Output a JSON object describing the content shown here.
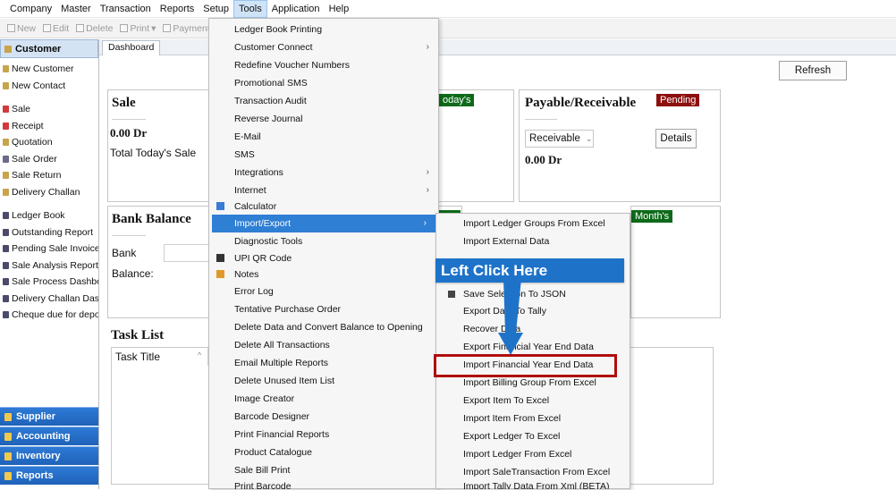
{
  "menubar": [
    "Company",
    "Master",
    "Transaction",
    "Reports",
    "Setup",
    "Tools",
    "Application",
    "Help"
  ],
  "toolbar": [
    "New",
    "Edit",
    "Delete",
    "Print",
    "Payment L"
  ],
  "sidebar": {
    "header": "Customer",
    "items": [
      "New Customer",
      "New Contact",
      "Sale",
      "Receipt",
      "Quotation",
      "Sale Order",
      "Sale Return",
      "Delivery Challan",
      "Ledger Book",
      "Outstanding Report",
      "Pending Sale Invoices",
      "Sale Analysis Report",
      "Sale Process Dashboa",
      "Delivery Challan Dashl",
      "Cheque due for depos"
    ],
    "bottom": [
      "Supplier",
      "Accounting",
      "Inventory",
      "Reports"
    ]
  },
  "tab": "Dashboard",
  "dashboard": {
    "refresh_label": "Refresh",
    "sale": {
      "title": "Sale",
      "value": "0.00 Dr",
      "caption": "Total Today's Sale"
    },
    "todays_badge": "oday's",
    "payable": {
      "title": "Payable/Receivable",
      "badge": "Pending",
      "select": "Receivable",
      "details_label": "Details",
      "value": "0.00 Dr"
    },
    "bank": {
      "title": "Bank Balance",
      "bank_label": "Bank",
      "balance_label": "Balance:"
    },
    "months_badge": "Month's",
    "tasklist": {
      "title": "Task List",
      "column": "Task Title"
    }
  },
  "tools_menu": [
    {
      "label": "Ledger Book Printing",
      "arrow": false
    },
    {
      "label": "Customer Connect",
      "arrow": true
    },
    {
      "label": "Redefine Voucher Numbers",
      "arrow": false
    },
    {
      "label": "Promotional SMS",
      "arrow": false
    },
    {
      "label": "Transaction Audit",
      "arrow": false
    },
    {
      "label": "Reverse Journal",
      "arrow": false
    },
    {
      "label": "E-Mail",
      "arrow": false
    },
    {
      "label": "SMS",
      "arrow": false
    },
    {
      "label": "Integrations",
      "arrow": true
    },
    {
      "label": "Internet",
      "arrow": true
    },
    {
      "label": "Calculator",
      "arrow": false,
      "icon": "calculator-icon"
    },
    {
      "label": "Import/Export",
      "arrow": true,
      "highlight": true
    },
    {
      "label": "Diagnostic Tools",
      "arrow": false
    },
    {
      "label": "UPI QR Code",
      "arrow": false,
      "icon": "qr-code-icon"
    },
    {
      "label": "Notes",
      "arrow": false,
      "icon": "notes-icon"
    },
    {
      "label": "Error Log",
      "arrow": false
    },
    {
      "label": "Tentative Purchase Order",
      "arrow": false
    },
    {
      "label": "Delete Data and Convert Balance to Opening",
      "arrow": false
    },
    {
      "label": "Delete All Transactions",
      "arrow": false
    },
    {
      "label": "Email Multiple Reports",
      "arrow": false
    },
    {
      "label": "Delete Unused Item List",
      "arrow": false
    },
    {
      "label": "Image Creator",
      "arrow": false
    },
    {
      "label": "Barcode Designer",
      "arrow": false
    },
    {
      "label": "Print Financial Reports",
      "arrow": false
    },
    {
      "label": "Product Catalogue",
      "arrow": false
    },
    {
      "label": "Sale Bill Print",
      "arrow": false
    },
    {
      "label": "Print Barcode",
      "arrow": false
    }
  ],
  "submenu": [
    "Import Ledger Groups From Excel",
    "Import External Data",
    "",
    "Save Selection To JSON",
    "Export Data To Tally",
    "Recover Data",
    "Export Financial Year End Data",
    "Import Financial Year End Data",
    "Import Billing Group From Excel",
    "Export Item To Excel",
    "Import Item From Excel",
    "Export Ledger To Excel",
    "Import Ledger From Excel",
    "Import  SaleTransaction From Excel",
    "Import Tally Data From Xml (BETA)"
  ],
  "callout": "Left Click Here",
  "colors": {
    "highlight": "#2f7fd4",
    "callout": "#1e73c9",
    "box": "#b00d0d",
    "green_badge": "#0e6a1a",
    "red_badge": "#8d0e0e"
  }
}
